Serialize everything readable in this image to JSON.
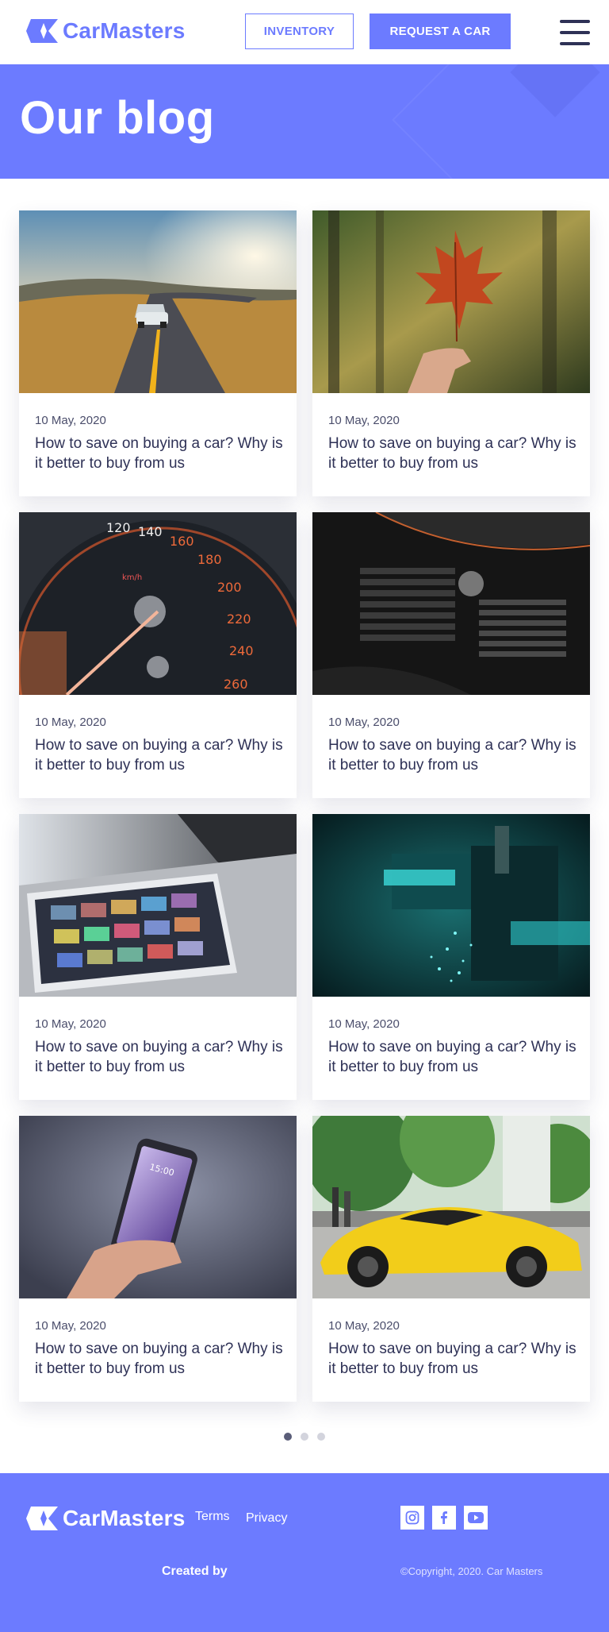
{
  "header": {
    "brand": "CarMasters",
    "inventory_label": "INVENTORY",
    "request_label": "REQUEST A CAR"
  },
  "hero": {
    "title": "Our blog"
  },
  "posts": [
    {
      "date": "10 May, 2020",
      "title": "How to save on buying a car? Why is it better to buy from us",
      "image": "sports-car-on-road"
    },
    {
      "date": "10 May, 2020",
      "title": "How to save on buying a car? Why is it better to buy from us",
      "image": "maple-leaf-in-hand"
    },
    {
      "date": "10 May, 2020",
      "title": "How to save on buying a car? Why is it better to buy from us",
      "image": "speedometer"
    },
    {
      "date": "10 May, 2020",
      "title": "How to save on buying a car? Why is it better to buy from us",
      "image": "motorcycle-engine"
    },
    {
      "date": "10 May, 2020",
      "title": "How to save on buying a car? Why is it better to buy from us",
      "image": "tablet-on-laptop"
    },
    {
      "date": "10 May, 2020",
      "title": "How to save on buying a car? Why is it better to buy from us",
      "image": "teal-machine"
    },
    {
      "date": "10 May, 2020",
      "title": "How to save on buying a car? Why is it better to buy from us",
      "image": "phone-in-hand"
    },
    {
      "date": "10 May, 2020",
      "title": "How to save on buying a car? Why is it better to buy from us",
      "image": "yellow-sports-car"
    }
  ],
  "pagination": {
    "total": 3,
    "active": 1
  },
  "footer": {
    "brand": "CarMasters",
    "terms_label": "Terms",
    "privacy_label": "Privacy",
    "social": [
      "instagram-icon",
      "facebook-icon",
      "youtube-icon"
    ],
    "created_by": "Created by",
    "copyright": "©Copyright, 2020. Car Masters"
  },
  "colors": {
    "accent": "#6c7bff",
    "text_dark": "#2e3156"
  }
}
